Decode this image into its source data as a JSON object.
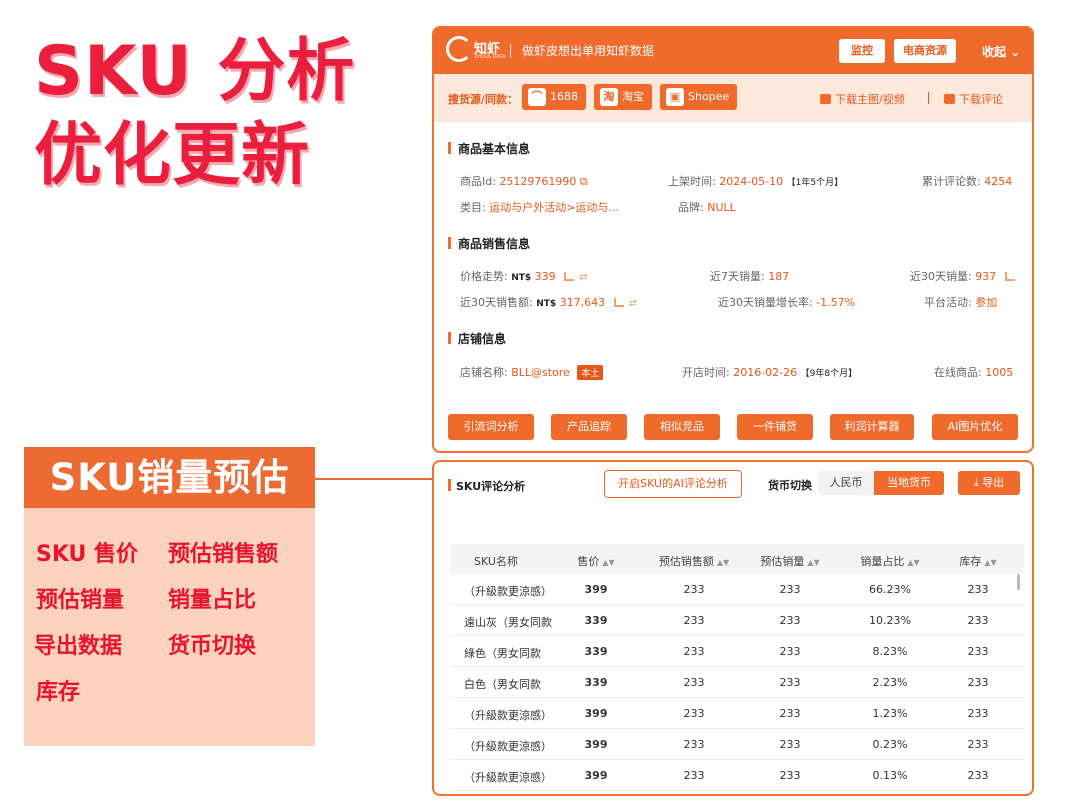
{
  "promo": {
    "title_line1": "SKU 分析",
    "title_line2": "优化更新",
    "banner": "SKU销量预估",
    "features": [
      "SKU 售价",
      "预估销售额",
      "预估销量",
      "销量占比",
      "导出数据",
      "货币切换",
      "库存"
    ]
  },
  "header": {
    "logo_text": "知虾",
    "logo_sub": "ZHIXIA DATA",
    "slogan": "做虾皮想出单用知虾数据",
    "monitor_label": "监控",
    "ecom_label": "电商资源",
    "collapse_label": "收起"
  },
  "source_bar": {
    "label": "搜货源/同款：",
    "buttons": [
      {
        "label": "1688",
        "icon": "1688-icon"
      },
      {
        "label": "淘宝",
        "icon": "taobao-icon"
      },
      {
        "label": "Shopee",
        "icon": "shopee-bag-icon"
      }
    ],
    "download_media": "下载主图/视频",
    "download_reviews": "下载评论"
  },
  "basic_info": {
    "title": "商品基本信息",
    "product_id_label": "商品Id:",
    "product_id": "25129761990",
    "listed_label": "上架时间:",
    "listed_date": "2024-05-10",
    "listed_age": "【1年5个月】",
    "reviews_label": "累计评论数:",
    "reviews": "4254",
    "category_label": "类目:",
    "category": "运动与户外活动>运动与...",
    "brand_label": "品牌:",
    "brand": "NULL"
  },
  "sales_info": {
    "title": "商品销售信息",
    "price_trend_label": "价格走势:",
    "currency": "NT$",
    "price": "339",
    "sales7_label": "近7天销量:",
    "sales7": "187",
    "sales30_label": "近30天销量:",
    "sales30": "937",
    "revenue30_label": "近30天销售额:",
    "revenue30": "317,643",
    "growth_label": "近30天销量增长率:",
    "growth": "-1.57%",
    "promo_label": "平台活动:",
    "promo": "参加"
  },
  "shop_info": {
    "title": "店铺信息",
    "name_label": "店铺名称:",
    "name": "BLL@store",
    "local_tag": "本土",
    "opened_label": "开店时间:",
    "opened_date": "2016-02-26",
    "opened_age": "【9年8个月】",
    "online_label": "在线商品:",
    "online": "1005"
  },
  "actions": [
    "引流词分析",
    "产品追踪",
    "相似竞品",
    "一件铺货",
    "利润计算器",
    "AI图片优化"
  ],
  "sku_panel": {
    "title": "SKU评论分析",
    "ai_button": "开启SKU的AI评论分析",
    "currency_label": "货币切换",
    "currency_rmb": "人民币",
    "currency_local": "当地货币",
    "export_label": "导出",
    "columns": [
      "SKU名称",
      "售价",
      "预估销售额",
      "预估销量",
      "销量占比",
      "库存"
    ],
    "rows": [
      {
        "name": "（升級款更涼感）",
        "price": "399",
        "revenue": "233",
        "sales": "233",
        "share": "66.23%",
        "stock": "233"
      },
      {
        "name": "遠山灰（男女同款",
        "price": "339",
        "revenue": "233",
        "sales": "233",
        "share": "10.23%",
        "stock": "233"
      },
      {
        "name": "綠色（男女同款",
        "price": "339",
        "revenue": "233",
        "sales": "233",
        "share": "8.23%",
        "stock": "233"
      },
      {
        "name": "白色（男女同款",
        "price": "339",
        "revenue": "233",
        "sales": "233",
        "share": "2.23%",
        "stock": "233"
      },
      {
        "name": "（升級款更涼感）",
        "price": "399",
        "revenue": "233",
        "sales": "233",
        "share": "1.23%",
        "stock": "233"
      },
      {
        "name": "（升級款更涼感）",
        "price": "399",
        "revenue": "233",
        "sales": "233",
        "share": "0.23%",
        "stock": "233"
      },
      {
        "name": "（升級款更涼感）",
        "price": "399",
        "revenue": "233",
        "sales": "233",
        "share": "0.13%",
        "stock": "233"
      }
    ]
  },
  "colors": {
    "accent": "#f06a2c",
    "promo_red": "#e8142e",
    "banner": "#ee6a33",
    "feature_bg": "#fbd2bd"
  }
}
